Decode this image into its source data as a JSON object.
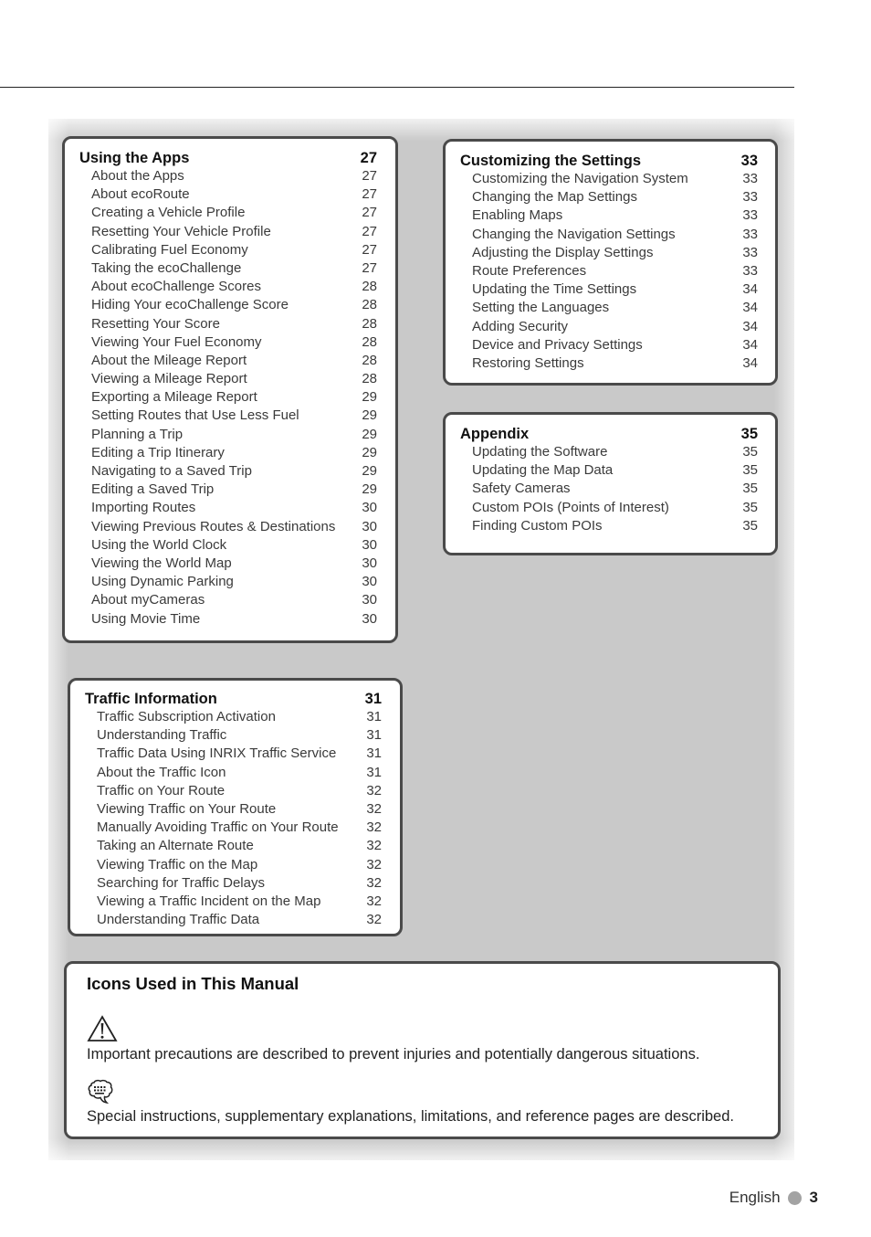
{
  "sections": {
    "apps": {
      "title": "Using the Apps",
      "page": "27",
      "entries": [
        {
          "label": "About the Apps",
          "page": "27"
        },
        {
          "label": "About ecoRoute",
          "page": "27"
        },
        {
          "label": "Creating a Vehicle Profile",
          "page": "27"
        },
        {
          "label": "Resetting Your Vehicle Profile",
          "page": "27"
        },
        {
          "label": "Calibrating Fuel Economy",
          "page": "27"
        },
        {
          "label": "Taking the ecoChallenge",
          "page": "27"
        },
        {
          "label": "About ecoChallenge Scores",
          "page": "28"
        },
        {
          "label": "Hiding Your ecoChallenge Score",
          "page": "28"
        },
        {
          "label": "Resetting Your Score",
          "page": "28"
        },
        {
          "label": "Viewing Your Fuel Economy",
          "page": "28"
        },
        {
          "label": "About the Mileage Report",
          "page": "28"
        },
        {
          "label": "Viewing a Mileage Report",
          "page": "28"
        },
        {
          "label": "Exporting a Mileage Report",
          "page": "29"
        },
        {
          "label": "Setting Routes that Use Less Fuel",
          "page": "29"
        },
        {
          "label": "Planning a Trip",
          "page": "29"
        },
        {
          "label": "Editing a Trip Itinerary",
          "page": "29"
        },
        {
          "label": "Navigating to a Saved Trip",
          "page": "29"
        },
        {
          "label": "Editing a Saved Trip",
          "page": "29"
        },
        {
          "label": "Importing Routes",
          "page": "30"
        },
        {
          "label": "Viewing Previous Routes & Destinations",
          "page": "30"
        },
        {
          "label": "Using the World Clock",
          "page": "30"
        },
        {
          "label": "Viewing the World Map",
          "page": "30"
        },
        {
          "label": "Using Dynamic Parking",
          "page": "30"
        },
        {
          "label": "About myCameras",
          "page": "30"
        },
        {
          "label": "Using Movie Time",
          "page": "30"
        }
      ]
    },
    "traffic": {
      "title": "Traffic Information",
      "page": "31",
      "entries": [
        {
          "label": "Traffic Subscription Activation",
          "page": "31"
        },
        {
          "label": "Understanding Traffic",
          "page": "31"
        },
        {
          "label": "Traffic Data Using INRIX Traffic Service",
          "page": "31"
        },
        {
          "label": "About the Traffic Icon",
          "page": "31"
        },
        {
          "label": "Traffic on Your Route",
          "page": "32"
        },
        {
          "label": "Viewing Traffic on Your Route",
          "page": "32"
        },
        {
          "label": "Manually Avoiding Traffic on Your Route",
          "page": "32"
        },
        {
          "label": "Taking an Alternate Route",
          "page": "32"
        },
        {
          "label": "Viewing Traffic on the Map",
          "page": "32"
        },
        {
          "label": "Searching for Traffic Delays",
          "page": "32"
        },
        {
          "label": "Viewing a Traffic Incident on the Map",
          "page": "32"
        },
        {
          "label": "Understanding Traffic Data",
          "page": "32"
        }
      ]
    },
    "settings": {
      "title": "Customizing the Settings",
      "page": "33",
      "entries": [
        {
          "label": "Customizing the Navigation System",
          "page": "33"
        },
        {
          "label": "Changing the Map Settings",
          "page": "33"
        },
        {
          "label": "Enabling Maps",
          "page": "33"
        },
        {
          "label": "Changing the Navigation Settings",
          "page": "33"
        },
        {
          "label": "Adjusting the Display Settings",
          "page": "33"
        },
        {
          "label": "Route Preferences",
          "page": "33"
        },
        {
          "label": "Updating the Time Settings",
          "page": "34"
        },
        {
          "label": "Setting the Languages",
          "page": "34"
        },
        {
          "label": "Adding Security",
          "page": "34"
        },
        {
          "label": "Device and Privacy Settings",
          "page": "34"
        },
        {
          "label": "Restoring Settings",
          "page": "34"
        }
      ]
    },
    "appendix": {
      "title": "Appendix",
      "page": "35",
      "entries": [
        {
          "label": "Updating the Software",
          "page": "35"
        },
        {
          "label": "Updating the Map Data",
          "page": "35"
        },
        {
          "label": "Safety Cameras",
          "page": "35"
        },
        {
          "label": "Custom POIs (Points of Interest)",
          "page": "35"
        },
        {
          "label": "Finding Custom POIs",
          "page": "35"
        }
      ]
    }
  },
  "icons_box": {
    "title": "Icons Used in This Manual",
    "items": [
      {
        "icon": "warning-icon",
        "text": "Important precautions are described to prevent injuries and potentially dangerous situations."
      },
      {
        "icon": "note-icon",
        "text": "Special instructions, supplementary explanations, limitations, and reference pages are described."
      }
    ]
  },
  "footer": {
    "language": "English",
    "page_number": "3"
  },
  "colors": {
    "panel_gray": "#c9c9c9",
    "box_border": "#4a4a4a",
    "footer_dot": "#a3a3a3"
  }
}
